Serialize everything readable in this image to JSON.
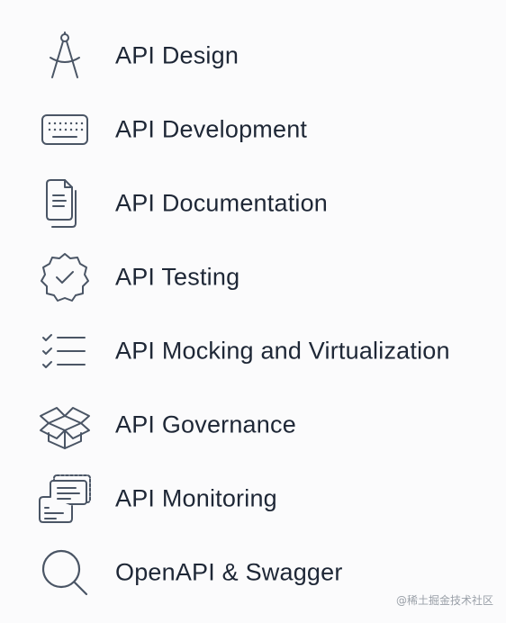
{
  "features": [
    {
      "label": "API Design",
      "icon": "compass-icon"
    },
    {
      "label": "API Development",
      "icon": "keyboard-icon"
    },
    {
      "label": "API Documentation",
      "icon": "document-icon"
    },
    {
      "label": "API Testing",
      "icon": "badge-check-icon"
    },
    {
      "label": "API Mocking and Virtualization",
      "icon": "checklist-icon"
    },
    {
      "label": "API Governance",
      "icon": "open-box-icon"
    },
    {
      "label": "API Monitoring",
      "icon": "chat-monitor-icon"
    },
    {
      "label": "OpenAPI & Swagger",
      "icon": "search-icon"
    }
  ],
  "watermark": "@稀土掘金技术社区",
  "colors": {
    "background": "#fbfbfc",
    "text": "#1e2736",
    "icon_stroke": "#4a5565"
  }
}
